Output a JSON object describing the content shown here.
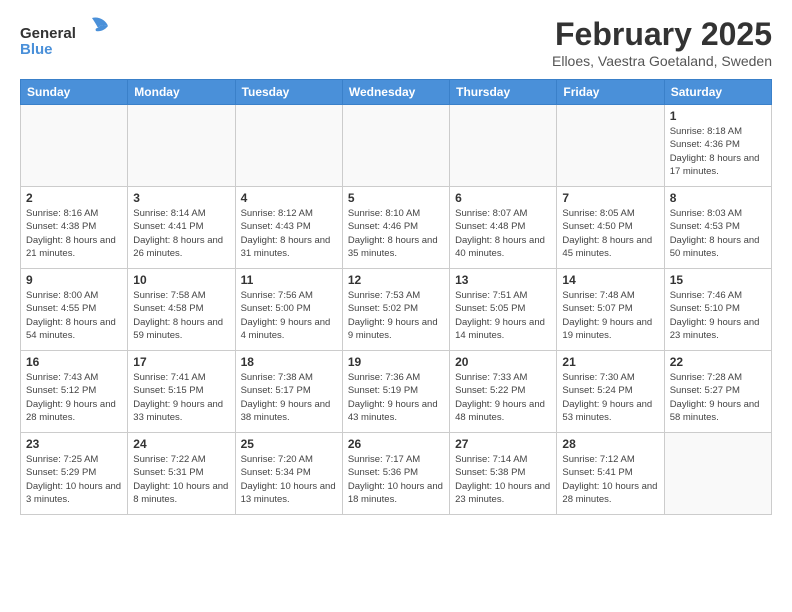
{
  "header": {
    "logo_general": "General",
    "logo_blue": "Blue",
    "month_title": "February 2025",
    "location": "Elloes, Vaestra Goetaland, Sweden"
  },
  "weekdays": [
    "Sunday",
    "Monday",
    "Tuesday",
    "Wednesday",
    "Thursday",
    "Friday",
    "Saturday"
  ],
  "weeks": [
    [
      {
        "day": "",
        "info": ""
      },
      {
        "day": "",
        "info": ""
      },
      {
        "day": "",
        "info": ""
      },
      {
        "day": "",
        "info": ""
      },
      {
        "day": "",
        "info": ""
      },
      {
        "day": "",
        "info": ""
      },
      {
        "day": "1",
        "info": "Sunrise: 8:18 AM\nSunset: 4:36 PM\nDaylight: 8 hours and 17 minutes."
      }
    ],
    [
      {
        "day": "2",
        "info": "Sunrise: 8:16 AM\nSunset: 4:38 PM\nDaylight: 8 hours and 21 minutes."
      },
      {
        "day": "3",
        "info": "Sunrise: 8:14 AM\nSunset: 4:41 PM\nDaylight: 8 hours and 26 minutes."
      },
      {
        "day": "4",
        "info": "Sunrise: 8:12 AM\nSunset: 4:43 PM\nDaylight: 8 hours and 31 minutes."
      },
      {
        "day": "5",
        "info": "Sunrise: 8:10 AM\nSunset: 4:46 PM\nDaylight: 8 hours and 35 minutes."
      },
      {
        "day": "6",
        "info": "Sunrise: 8:07 AM\nSunset: 4:48 PM\nDaylight: 8 hours and 40 minutes."
      },
      {
        "day": "7",
        "info": "Sunrise: 8:05 AM\nSunset: 4:50 PM\nDaylight: 8 hours and 45 minutes."
      },
      {
        "day": "8",
        "info": "Sunrise: 8:03 AM\nSunset: 4:53 PM\nDaylight: 8 hours and 50 minutes."
      }
    ],
    [
      {
        "day": "9",
        "info": "Sunrise: 8:00 AM\nSunset: 4:55 PM\nDaylight: 8 hours and 54 minutes."
      },
      {
        "day": "10",
        "info": "Sunrise: 7:58 AM\nSunset: 4:58 PM\nDaylight: 8 hours and 59 minutes."
      },
      {
        "day": "11",
        "info": "Sunrise: 7:56 AM\nSunset: 5:00 PM\nDaylight: 9 hours and 4 minutes."
      },
      {
        "day": "12",
        "info": "Sunrise: 7:53 AM\nSunset: 5:02 PM\nDaylight: 9 hours and 9 minutes."
      },
      {
        "day": "13",
        "info": "Sunrise: 7:51 AM\nSunset: 5:05 PM\nDaylight: 9 hours and 14 minutes."
      },
      {
        "day": "14",
        "info": "Sunrise: 7:48 AM\nSunset: 5:07 PM\nDaylight: 9 hours and 19 minutes."
      },
      {
        "day": "15",
        "info": "Sunrise: 7:46 AM\nSunset: 5:10 PM\nDaylight: 9 hours and 23 minutes."
      }
    ],
    [
      {
        "day": "16",
        "info": "Sunrise: 7:43 AM\nSunset: 5:12 PM\nDaylight: 9 hours and 28 minutes."
      },
      {
        "day": "17",
        "info": "Sunrise: 7:41 AM\nSunset: 5:15 PM\nDaylight: 9 hours and 33 minutes."
      },
      {
        "day": "18",
        "info": "Sunrise: 7:38 AM\nSunset: 5:17 PM\nDaylight: 9 hours and 38 minutes."
      },
      {
        "day": "19",
        "info": "Sunrise: 7:36 AM\nSunset: 5:19 PM\nDaylight: 9 hours and 43 minutes."
      },
      {
        "day": "20",
        "info": "Sunrise: 7:33 AM\nSunset: 5:22 PM\nDaylight: 9 hours and 48 minutes."
      },
      {
        "day": "21",
        "info": "Sunrise: 7:30 AM\nSunset: 5:24 PM\nDaylight: 9 hours and 53 minutes."
      },
      {
        "day": "22",
        "info": "Sunrise: 7:28 AM\nSunset: 5:27 PM\nDaylight: 9 hours and 58 minutes."
      }
    ],
    [
      {
        "day": "23",
        "info": "Sunrise: 7:25 AM\nSunset: 5:29 PM\nDaylight: 10 hours and 3 minutes."
      },
      {
        "day": "24",
        "info": "Sunrise: 7:22 AM\nSunset: 5:31 PM\nDaylight: 10 hours and 8 minutes."
      },
      {
        "day": "25",
        "info": "Sunrise: 7:20 AM\nSunset: 5:34 PM\nDaylight: 10 hours and 13 minutes."
      },
      {
        "day": "26",
        "info": "Sunrise: 7:17 AM\nSunset: 5:36 PM\nDaylight: 10 hours and 18 minutes."
      },
      {
        "day": "27",
        "info": "Sunrise: 7:14 AM\nSunset: 5:38 PM\nDaylight: 10 hours and 23 minutes."
      },
      {
        "day": "28",
        "info": "Sunrise: 7:12 AM\nSunset: 5:41 PM\nDaylight: 10 hours and 28 minutes."
      },
      {
        "day": "",
        "info": ""
      }
    ]
  ]
}
